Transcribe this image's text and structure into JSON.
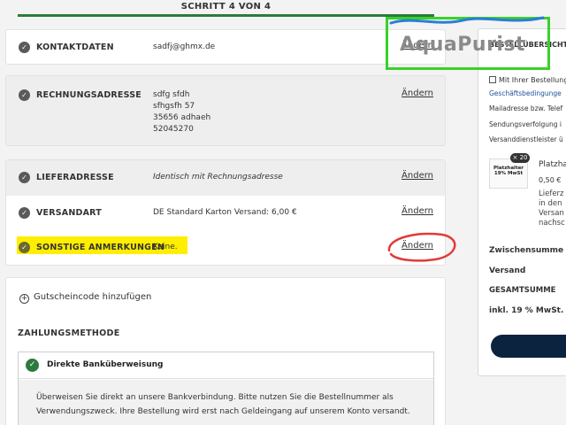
{
  "step": {
    "label": "SCHRITT 4 VON 4"
  },
  "logo": {
    "text": "AquaPurist"
  },
  "contact": {
    "label": "KONTAKTDATEN",
    "value": "sadfj@ghmx.de",
    "edit": "Ändern"
  },
  "billing": {
    "label": "RECHNUNGSADRESSE",
    "lines": [
      "sdfg sfdh",
      "sfhgsfh 57",
      "35656 adhaeh",
      "52045270"
    ],
    "edit": "Ändern"
  },
  "delivery": {
    "label": "LIEFERADRESSE",
    "value": "Identisch mit Rechnungsadresse",
    "edit": "Ändern"
  },
  "shipping": {
    "label": "VERSANDART",
    "value": "DE Standard Karton Versand: 6,00 €",
    "edit": "Ändern"
  },
  "remarks": {
    "label": "SONSTIGE ANMERKUNGEN",
    "value": "Keine.",
    "edit": "Ändern"
  },
  "coupon": {
    "icon": "plus-circle-icon",
    "label": "Gutscheincode hinzufügen"
  },
  "payment": {
    "title": "ZAHLUNGSMETHODE",
    "method": "Direkte Banküberweisung",
    "description_1": "Überweisen Sie direkt an unsere Bankverbindung. Bitte nutzen Sie die Bestellnummer als",
    "description_2": "Verwendungszweck. Ihre Bestellung wird erst nach Geldeingang auf unserem Konto versandt."
  },
  "summary": {
    "title": "BESTELLÜBERSICHT",
    "checkbox_text": "Mit Ihrer Bestellung",
    "lines": [
      "Geschäftsbedingunge",
      "Mailadresse bzw. Telef",
      "Sendungsverfolgung i",
      "Versanddienstleister ü"
    ],
    "product": {
      "badge": "× 20",
      "image_text_1": "Platzhalter",
      "image_text_2": "19% MwSt",
      "name": "Platzha",
      "price": "0,50 €",
      "note": [
        "Lieferz",
        "in den",
        "Versan",
        "nachsc"
      ]
    },
    "subtotal_label": "Zwischensumme",
    "shipping_label": "Versand",
    "total_label": "GESAMTSUMME",
    "tax_label": "inkl. 19 % MwSt."
  },
  "colors": {
    "accent_green": "#2d7a3e",
    "highlight": "#ffee00",
    "annotation_red": "#e23a3a",
    "logo_frame": "#39d12a",
    "button_navy": "#0c2340"
  }
}
